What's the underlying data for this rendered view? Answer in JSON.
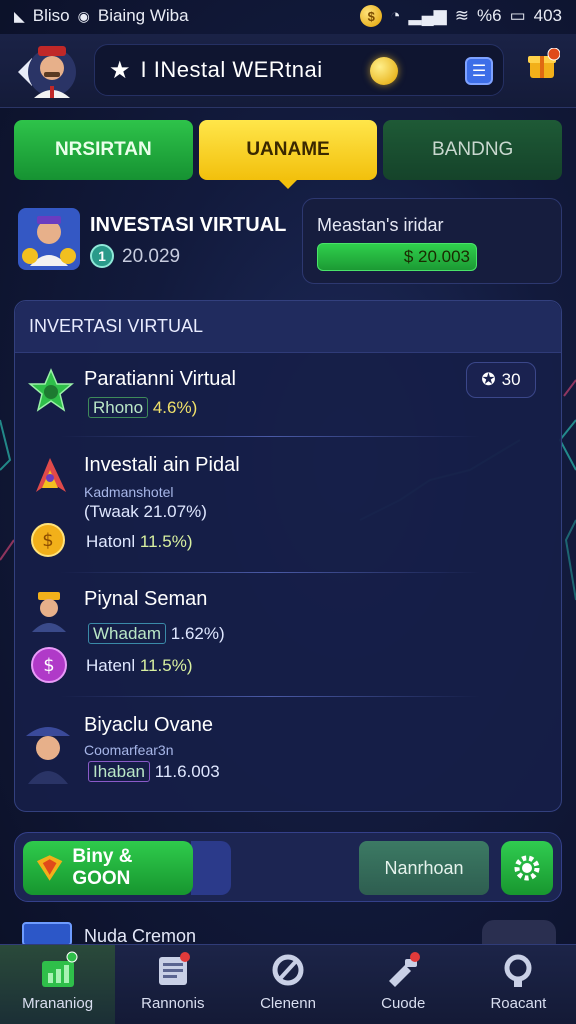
{
  "status_bar": {
    "left_text": "Bliso",
    "carrier": "Biaing Wiba",
    "right_text": "%6",
    "battery_text": "403"
  },
  "header": {
    "title": "I INestal WERtnai"
  },
  "tabs": [
    {
      "label": "NRSIRTAN"
    },
    {
      "label": "UANAME"
    },
    {
      "label": "BANDNG"
    }
  ],
  "profile": {
    "name": "INVESTASI VIRTUAL",
    "level": "1",
    "score": "20.029"
  },
  "balance": {
    "label": "Meastan's iridar",
    "amount": "$ 20.003"
  },
  "panel": {
    "title": "INVERTASI VIRTUAL",
    "badge_value": "30",
    "items": [
      {
        "name": "Paratianni Virtual",
        "rate_label": "Rhono",
        "rate_value": "4.6%)"
      },
      {
        "name": "Investali ain Pidal",
        "sub": "Kadmanshotel",
        "rate_label": "(Twaak",
        "rate_value": "21.07%)",
        "rate2_label": "Hatonl",
        "rate2_value": "11.5%)"
      },
      {
        "name": "Piynal Seman",
        "rate_label": "Whadam",
        "rate_value": "1.62%)",
        "rate2_label": "Hatenl",
        "rate2_value": "11.5%)"
      },
      {
        "name": "Biyaclu Ovane",
        "sub": "Coomarfear3n",
        "rate_label": "Ihaban",
        "rate_value": "11.6.003"
      }
    ]
  },
  "actions": {
    "buy_label": "Biny & GOON",
    "secondary_label": "Nanrhoan"
  },
  "partial_row": {
    "text": "Nuda Cremon"
  },
  "bottom_nav": [
    {
      "label": "Mrananiog"
    },
    {
      "label": "Rannonis"
    },
    {
      "label": "Clenenn"
    },
    {
      "label": "Cuode"
    },
    {
      "label": "Roacant"
    }
  ],
  "colors": {
    "accent_green": "#22b03f",
    "accent_yellow": "#f5cb14",
    "panel_bg": "#161e48"
  }
}
